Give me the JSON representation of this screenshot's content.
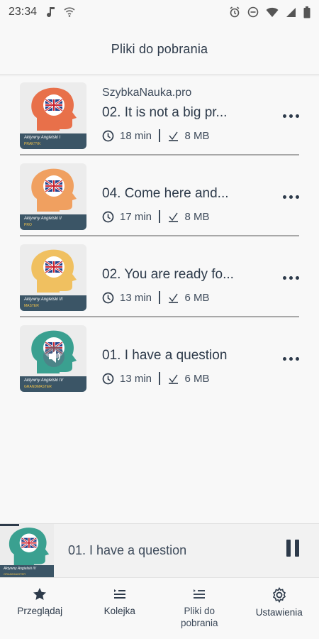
{
  "status_bar": {
    "time": "23:34",
    "left_icons": [
      "music-note-icon",
      "wifi-calling-icon"
    ],
    "right_icons": [
      "alarm-icon",
      "do-not-disturb-icon",
      "wifi-icon",
      "signal-icon",
      "battery-icon"
    ]
  },
  "header": {
    "title": "Pliki do pobrania"
  },
  "downloads": [
    {
      "source": "SzybkaNauka.pro",
      "title": "02. It is not a big pr...",
      "duration": "18 min",
      "size": "8 MB",
      "cover_line1": "Aktywny Angielski I",
      "cover_line2": "PRAKTYK",
      "cover_color": "#e8704a"
    },
    {
      "source": "",
      "title": "04. Come here and...",
      "duration": "17 min",
      "size": "8 MB",
      "cover_line1": "Aktywny Angielski II",
      "cover_line2": "PRO",
      "cover_color": "#f0a060"
    },
    {
      "source": "",
      "title": "02. You are ready fo...",
      "duration": "13 min",
      "size": "6 MB",
      "cover_line1": "Aktywny Angielski III",
      "cover_line2": "MASTER",
      "cover_color": "#f0c060"
    },
    {
      "source": "",
      "title": "01. I have a question",
      "duration": "13 min",
      "size": "6 MB",
      "cover_line1": "Aktywny Angielski IV",
      "cover_line2": "GRANDMASTER",
      "cover_color": "#3aa090"
    }
  ],
  "mini_player": {
    "title": "01. I have a question",
    "cover_line1": "Aktywny Angielski IV",
    "cover_line2": "GRANDMASTER",
    "cover_color": "#3aa090",
    "progress": 0.06
  },
  "bottom_nav": [
    {
      "label": "Przeglądaj",
      "icon": "star-icon",
      "active": false
    },
    {
      "label": "Kolejka",
      "icon": "queue-list-icon",
      "active": false
    },
    {
      "label": "Pliki do\npobrania",
      "icon": "download-list-icon",
      "active": true
    },
    {
      "label": "Ustawienia",
      "icon": "gear-icon",
      "active": false
    }
  ],
  "colors": {
    "primary": "#2d3a4a",
    "divider": "#a8a8a8",
    "background": "#f8f8f8"
  }
}
